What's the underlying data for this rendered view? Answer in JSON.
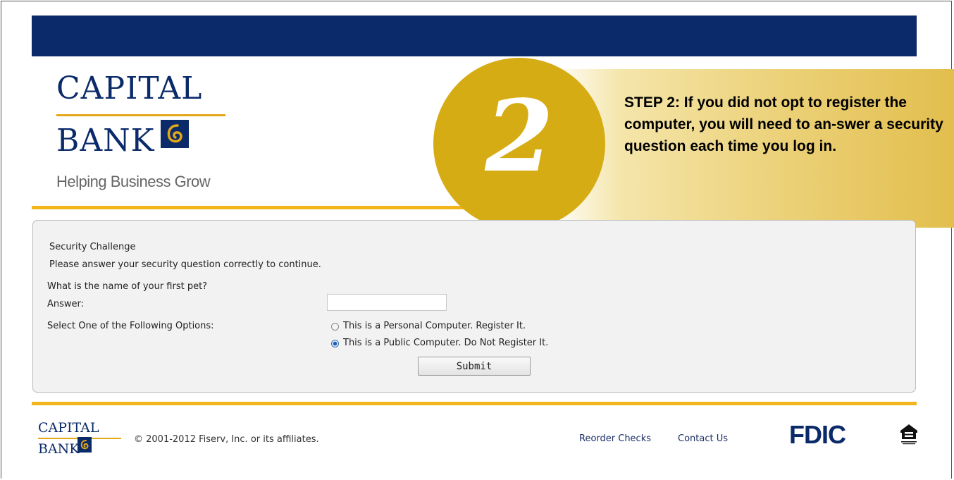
{
  "brand": {
    "name_line1": "CAPITAL",
    "name_line2": "BANK",
    "tagline": "Helping Business Grow"
  },
  "callout": {
    "step_number": "2",
    "text": "STEP 2: If you did not opt to register the computer, you will need to an-swer a security question each time you log in."
  },
  "form": {
    "title": "Security Challenge",
    "instruction": "Please answer your security question correctly to continue.",
    "question": "What is the name of your first pet?",
    "answer_label": "Answer:",
    "answer_value": "",
    "options_label": "Select One of the Following Options:",
    "options": [
      {
        "label": "This is a Personal Computer. Register It.",
        "selected": false
      },
      {
        "label": "This is a Public Computer. Do Not Register It.",
        "selected": true
      }
    ],
    "submit_label": "Submit"
  },
  "footer": {
    "brand_line1": "CAPITAL",
    "brand_line2": "BANK",
    "copyright": "© 2001-2012 Fiserv, Inc. or its affiliates.",
    "links": [
      "Reorder Checks",
      "Contact Us"
    ],
    "fdic_label": "FDIC",
    "ehl_label": "EQUAL HOUSING LENDER"
  },
  "colors": {
    "navy": "#0a2a69",
    "gold": "#f2b51c",
    "callout_gold": "#d6ac14"
  }
}
